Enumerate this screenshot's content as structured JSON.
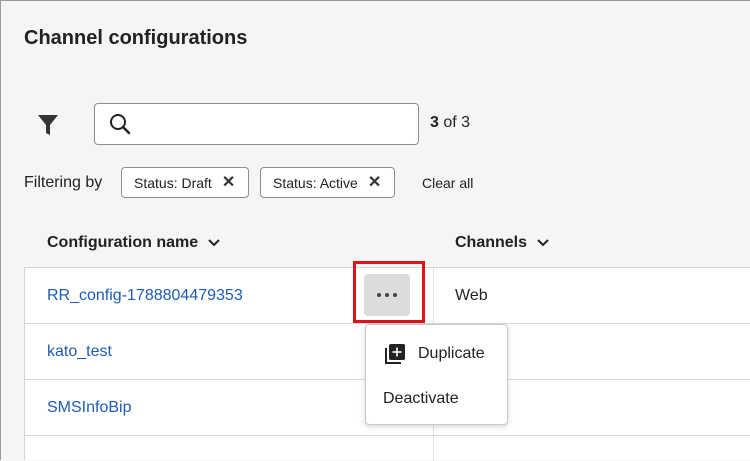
{
  "header": {
    "title": "Channel configurations"
  },
  "search": {
    "value": "",
    "placeholder": ""
  },
  "results": {
    "count": "3",
    "suffix": "of 3"
  },
  "filters": {
    "label": "Filtering by",
    "chips": [
      {
        "label": "Status: Draft",
        "close": "✕"
      },
      {
        "label": "Status: Active",
        "close": "✕"
      }
    ],
    "clear_all": "Clear all"
  },
  "table": {
    "columns": [
      "Configuration name",
      "Channels"
    ],
    "rows": [
      {
        "name": "RR_config-1788804479353",
        "channel": "Web"
      },
      {
        "name": "kato_test",
        "channel": ""
      },
      {
        "name": "SMSInfoBip",
        "channel": ""
      }
    ]
  },
  "context_menu": {
    "items": [
      {
        "label": "Duplicate",
        "icon": "duplicate-icon"
      },
      {
        "label": "Deactivate"
      }
    ]
  },
  "colors": {
    "link": "#1d5cb4",
    "highlight": "#e0111a"
  }
}
